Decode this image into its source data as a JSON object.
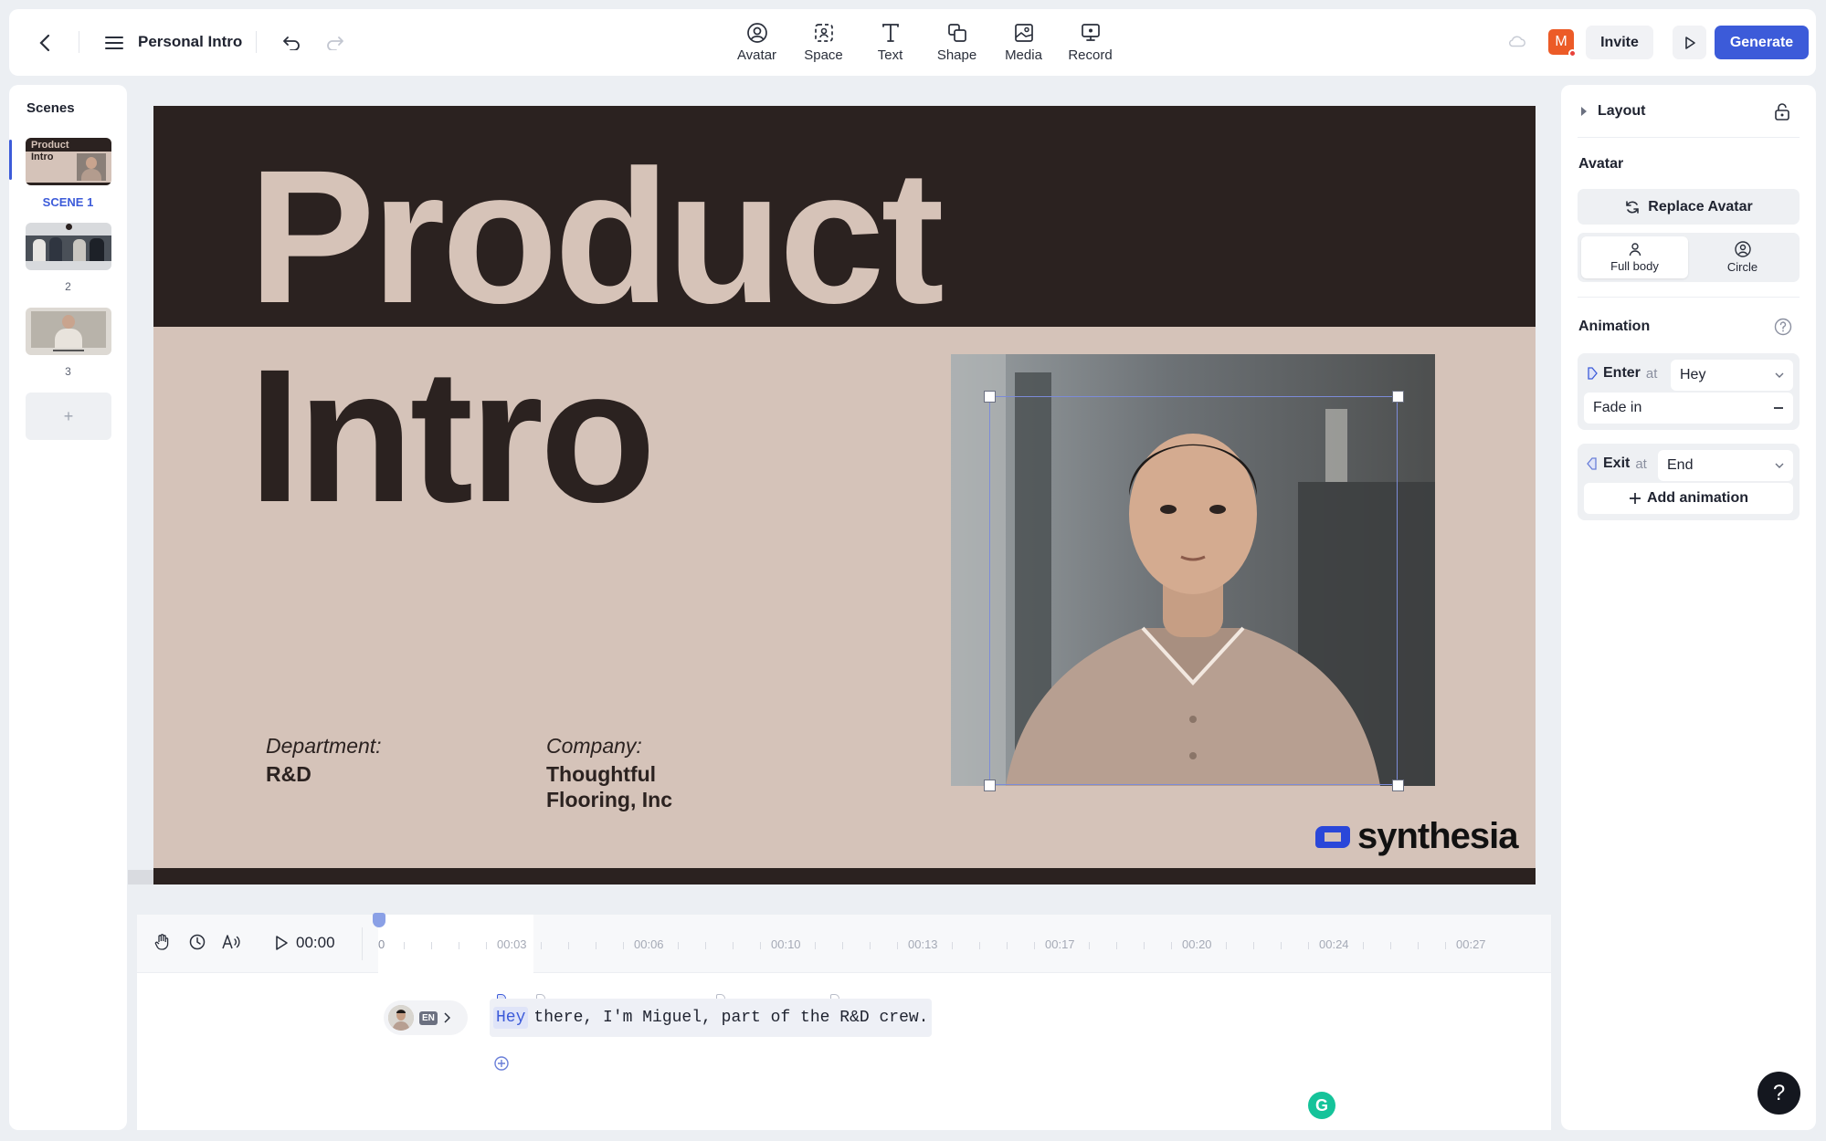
{
  "header": {
    "title": "Personal Intro",
    "tools": [
      {
        "label": "Avatar",
        "icon": "avatar-icon"
      },
      {
        "label": "Space",
        "icon": "space-icon"
      },
      {
        "label": "Text",
        "icon": "text-icon"
      },
      {
        "label": "Shape",
        "icon": "shape-icon"
      },
      {
        "label": "Media",
        "icon": "media-icon"
      },
      {
        "label": "Record",
        "icon": "record-icon"
      }
    ],
    "user_initial": "M",
    "invite_label": "Invite",
    "generate_label": "Generate"
  },
  "scenes": {
    "title": "Scenes",
    "items": [
      {
        "label": "SCENE 1",
        "thumb_text_1": "Product",
        "thumb_text_2": "Intro",
        "active": true
      },
      {
        "label": "2",
        "active": false
      },
      {
        "label": "3",
        "active": false
      }
    ],
    "add_label": "+"
  },
  "slide": {
    "title_line_1": "Product",
    "title_line_2": "Intro",
    "department_label": "Department:",
    "department_value": "R&D",
    "company_label": "Company:",
    "company_value_1": "Thoughtful",
    "company_value_2": "Flooring, Inc",
    "logo_text": "synthesia"
  },
  "right_panel": {
    "layout_label": "Layout",
    "avatar_heading": "Avatar",
    "replace_avatar_label": "Replace Avatar",
    "options": [
      {
        "label": "Full body",
        "active": true
      },
      {
        "label": "Circle",
        "active": false
      }
    ],
    "animation_heading": "Animation",
    "enter_label": "Enter",
    "enter_at": "at",
    "enter_value": "Hey",
    "enter_effect": "Fade in",
    "exit_label": "Exit",
    "exit_at": "at",
    "exit_value": "End",
    "add_animation_label": "Add animation"
  },
  "timeline": {
    "time": "00:00",
    "ruler": [
      "0",
      "00:03",
      "00:06",
      "00:10",
      "00:13",
      "00:17",
      "00:20",
      "00:24",
      "00:27"
    ],
    "language": "EN",
    "script_highlight": "Hey",
    "script_rest": "there, I'm Miguel, part of the R&D crew."
  },
  "colors": {
    "accent": "#3c5bd9",
    "slide_dark": "#2b2220",
    "slide_light": "#d5c3b9",
    "user_badge": "#ec5b27"
  }
}
